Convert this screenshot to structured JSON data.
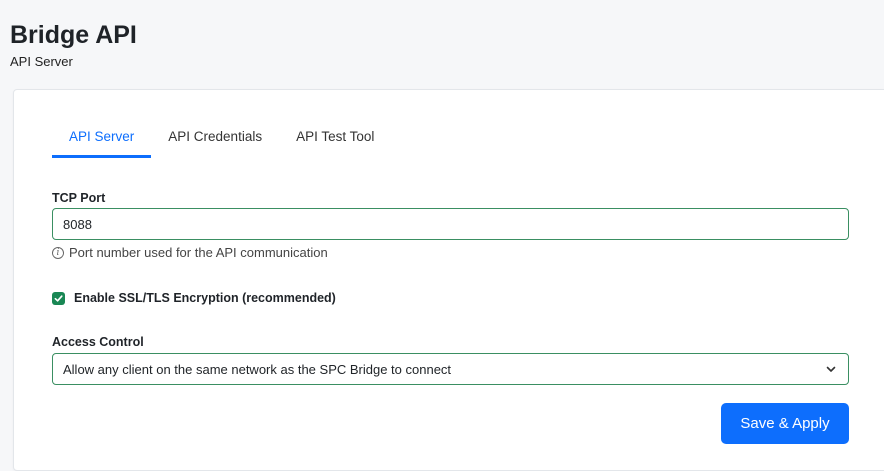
{
  "header": {
    "title": "Bridge API",
    "subtitle": "API Server"
  },
  "tabs": [
    {
      "label": "API Server",
      "active": true
    },
    {
      "label": "API Credentials",
      "active": false
    },
    {
      "label": "API Test Tool",
      "active": false
    }
  ],
  "form": {
    "tcp_port": {
      "label": "TCP Port",
      "value": "8088",
      "help": "Port number used for the API communication",
      "help_icon": "info-icon"
    },
    "ssl": {
      "label": "Enable SSL/TLS Encryption (recommended)",
      "checked": true
    },
    "access_control": {
      "label": "Access Control",
      "selected": "Allow any client on the same network as the SPC Bridge to connect"
    },
    "save_label": "Save & Apply"
  },
  "colors": {
    "accent": "#0d6efd",
    "valid_border": "#3a8f62",
    "checkbox": "#198754",
    "background": "#f6f7f9"
  }
}
